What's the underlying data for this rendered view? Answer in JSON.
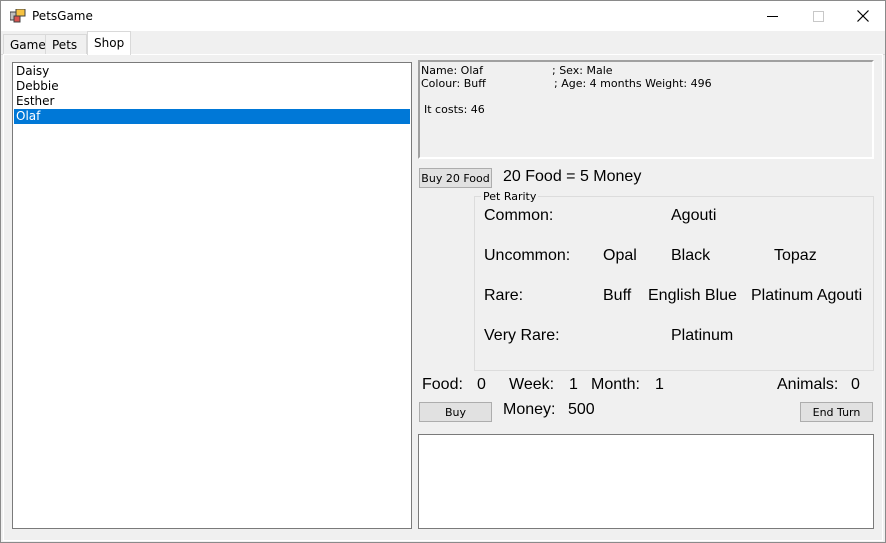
{
  "window": {
    "title": "PetsGame",
    "icon": "app-icon",
    "controls": [
      "minimize-icon",
      "maximize-icon",
      "close-icon"
    ]
  },
  "tabs": [
    {
      "label": "Game"
    },
    {
      "label": "Pets"
    },
    {
      "label": "Shop",
      "active": true
    }
  ],
  "pet_list": {
    "items": [
      "Daisy",
      "Debbie",
      "Esther",
      "Olaf"
    ],
    "selected_index": 3
  },
  "pet_info": {
    "name": "Name: Olaf",
    "sex": "; Sex: Male",
    "colour": "Colour: Buff",
    "age_weight": "; Age: 4 months Weight: 496",
    "cost": "It costs: 46"
  },
  "food_shop": {
    "buy_button": "Buy 20 Food",
    "rate_text": "20 Food = 5 Money"
  },
  "rarity": {
    "group_label": "Pet Rarity",
    "rows": [
      {
        "label": "Common:",
        "cells": [
          "",
          "Agouti",
          ""
        ]
      },
      {
        "label": "Uncommon:",
        "cells": [
          "Opal",
          "Black",
          "Topaz"
        ]
      },
      {
        "label": "Rare:",
        "cells": [
          "Buff",
          "English Blue",
          "Platinum Agouti"
        ]
      },
      {
        "label": "Very Rare:",
        "cells": [
          "",
          "Platinum",
          ""
        ]
      }
    ]
  },
  "status": {
    "food_label": "Food:",
    "food_value": "0",
    "week_label": "Week:",
    "week_value": "1",
    "month_label": "Month:",
    "month_value": "1",
    "animals_label": "Animals:",
    "animals_value": "0",
    "money_label": "Money:",
    "money_value": "500"
  },
  "actions": {
    "buy_button": "Buy",
    "end_turn_button": "End Turn"
  },
  "log": {
    "text": ""
  },
  "colors": {
    "selection": "#0078d7",
    "button_face": "#e1e1e1",
    "window_bg": "#f0f0f0"
  }
}
